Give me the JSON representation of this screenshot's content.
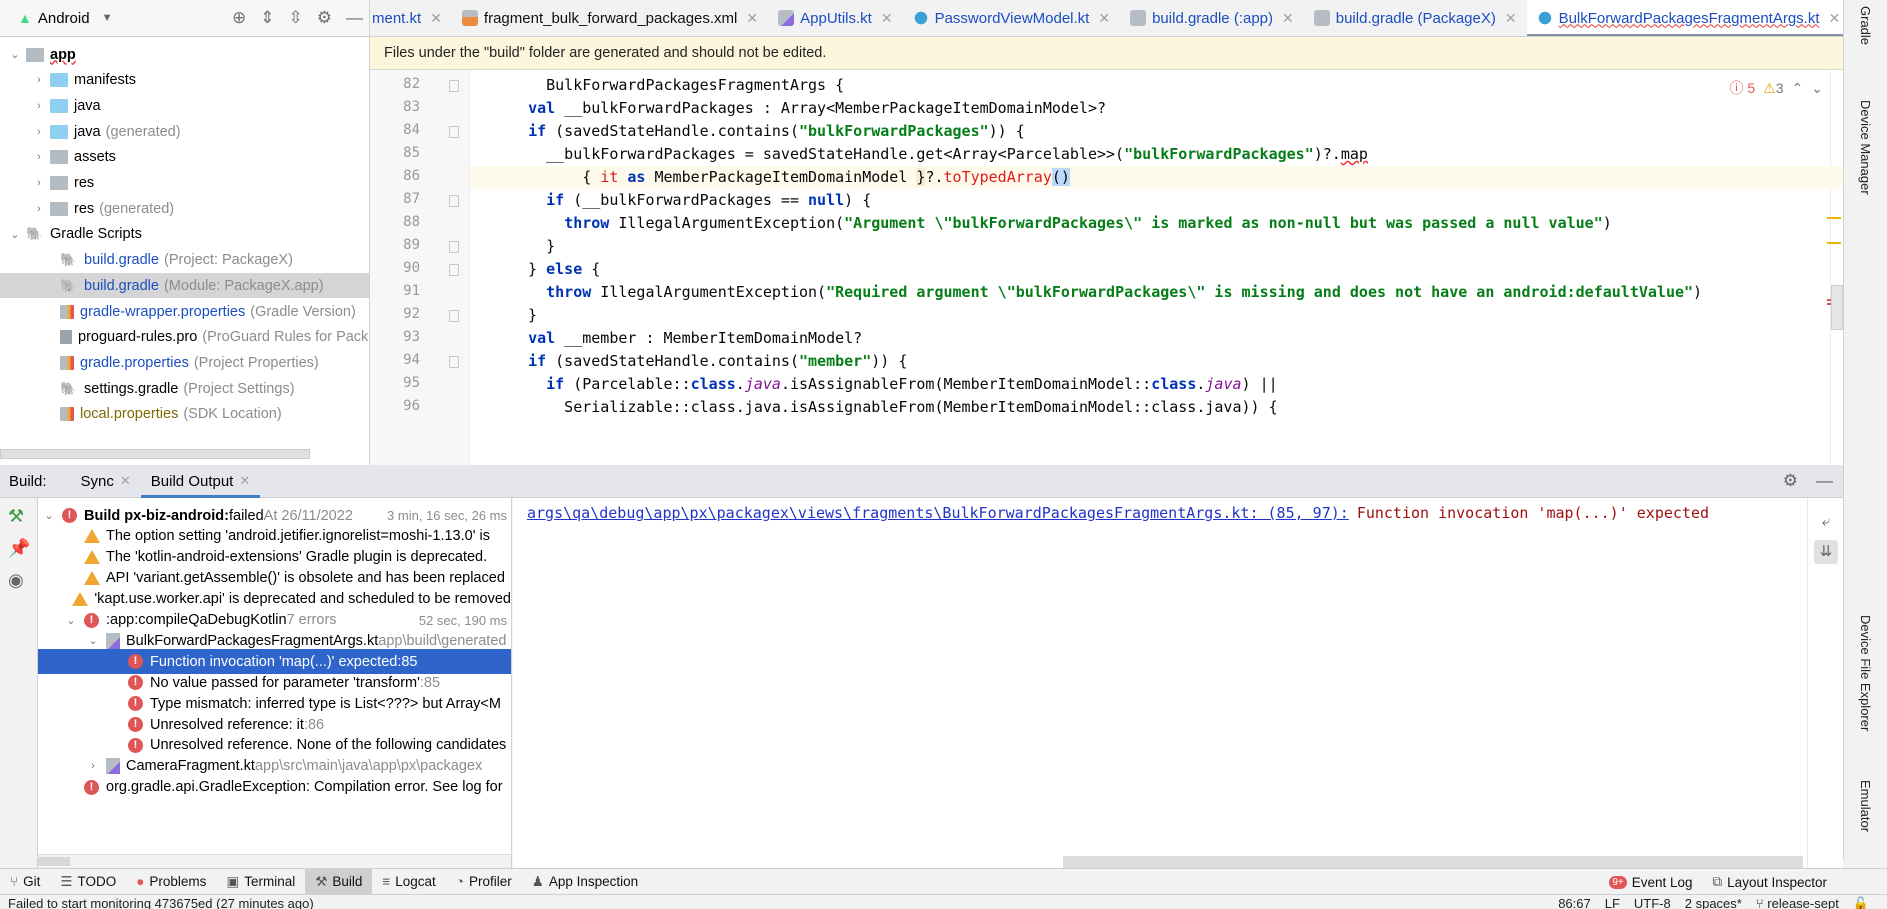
{
  "project_panel": {
    "view_selector": "Android",
    "tools": [
      "locate-icon",
      "expand-all-icon",
      "collapse-all-icon",
      "gear-icon",
      "minimize-icon"
    ],
    "tree": [
      {
        "label": "app",
        "detail": "",
        "level": 0,
        "expanded": true,
        "kind": "module",
        "bold": true
      },
      {
        "label": "manifests",
        "detail": "",
        "level": 1,
        "expanded": false,
        "kind": "folder-blue"
      },
      {
        "label": "java",
        "detail": "",
        "level": 1,
        "expanded": false,
        "kind": "folder-blue"
      },
      {
        "label": "java",
        "detail": "(generated)",
        "level": 1,
        "expanded": false,
        "kind": "folder-generated"
      },
      {
        "label": "assets",
        "detail": "",
        "level": 1,
        "expanded": false,
        "kind": "folder-res"
      },
      {
        "label": "res",
        "detail": "",
        "level": 1,
        "expanded": false,
        "kind": "folder-res"
      },
      {
        "label": "res",
        "detail": "(generated)",
        "level": 1,
        "expanded": false,
        "kind": "folder-res"
      },
      {
        "label": "Gradle Scripts",
        "detail": "",
        "level": 0,
        "expanded": true,
        "kind": "gradle"
      },
      {
        "label": "build.gradle",
        "detail": "(Project: PackageX)",
        "level": 1,
        "kind": "gradle-file",
        "color": "blue"
      },
      {
        "label": "build.gradle",
        "detail": "(Module: PackageX.app)",
        "level": 1,
        "kind": "gradle-file",
        "color": "blue",
        "selected": true
      },
      {
        "label": "gradle-wrapper.properties",
        "detail": "(Gradle Version)",
        "level": 1,
        "kind": "properties",
        "color": "blue"
      },
      {
        "label": "proguard-rules.pro",
        "detail": "(ProGuard Rules for Pack",
        "level": 1,
        "kind": "text-file",
        "color": "black"
      },
      {
        "label": "gradle.properties",
        "detail": "(Project Properties)",
        "level": 1,
        "kind": "properties",
        "color": "blue"
      },
      {
        "label": "settings.gradle",
        "detail": "(Project Settings)",
        "level": 1,
        "kind": "gradle-file",
        "color": "black"
      },
      {
        "label": "local.properties",
        "detail": "(SDK Location)",
        "level": 1,
        "kind": "properties",
        "color": "olive"
      }
    ]
  },
  "editor_tabs": [
    {
      "label": "ment.kt",
      "icon": "kotlin-file-icon",
      "active": false
    },
    {
      "label": "fragment_bulk_forward_packages.xml",
      "icon": "xml-file-icon",
      "active": false
    },
    {
      "label": "AppUtils.kt",
      "icon": "kotlin-file-icon",
      "active": false
    },
    {
      "label": "PasswordViewModel.kt",
      "icon": "kotlin-class-icon",
      "active": false
    },
    {
      "label": "build.gradle (:app)",
      "icon": "gradle-icon",
      "active": false
    },
    {
      "label": "build.gradle (PackageX)",
      "icon": "gradle-icon",
      "active": false
    },
    {
      "label": "BulkForwardPackagesFragmentArgs.kt",
      "icon": "kotlin-class-icon",
      "active": true,
      "has_errors": true
    }
  ],
  "banner": "Files under the \"build\" folder are generated and should not be edited.",
  "inspections": {
    "errors": "5",
    "warnings": "3"
  },
  "code": {
    "lines": [
      {
        "n": "82",
        "fold": true,
        "segs": [
          {
            "t": "    BulkForwardPackagesFragmentArgs {",
            "c": ""
          }
        ]
      },
      {
        "n": "83",
        "segs": [
          {
            "t": "  ",
            "c": ""
          },
          {
            "t": "val",
            "c": "kw"
          },
          {
            "t": " __bulkForwardPackages : Array<MemberPackageItemDomainModel>?",
            "c": ""
          }
        ]
      },
      {
        "n": "84",
        "fold": true,
        "segs": [
          {
            "t": "  ",
            "c": ""
          },
          {
            "t": "if",
            "c": "kw"
          },
          {
            "t": " (savedStateHandle.contains(",
            "c": ""
          },
          {
            "t": "\"bulkForwardPackages\"",
            "c": "str"
          },
          {
            "t": ")) {",
            "c": ""
          }
        ]
      },
      {
        "n": "85",
        "segs": [
          {
            "t": "    __bulkForwardPackages = savedStateHandle.get<Array<Parcelable>>(",
            "c": ""
          },
          {
            "t": "\"bulkForwardPackages\"",
            "c": "str"
          },
          {
            "t": ")?.",
            "c": ""
          },
          {
            "t": "map",
            "c": "err-u"
          }
        ]
      },
      {
        "n": "86",
        "hl": true,
        "segs": [
          {
            "t": "        { ",
            "c": ""
          },
          {
            "t": "it",
            "c": "red"
          },
          {
            "t": " ",
            "c": ""
          },
          {
            "t": "as",
            "c": "kw"
          },
          {
            "t": " MemberPackageItemDomainModel ",
            "c": ""
          },
          {
            "t": "}",
            "c": "ylbg"
          },
          {
            "t": "?.",
            "c": ""
          },
          {
            "t": "toTypedArray",
            "c": "red"
          },
          {
            "t": "()",
            "c": "bm"
          }
        ]
      },
      {
        "n": "87",
        "fold": true,
        "segs": [
          {
            "t": "    ",
            "c": ""
          },
          {
            "t": "if",
            "c": "kw"
          },
          {
            "t": " (__bulkForwardPackages == ",
            "c": ""
          },
          {
            "t": "null",
            "c": "kw"
          },
          {
            "t": ") {",
            "c": ""
          }
        ]
      },
      {
        "n": "88",
        "segs": [
          {
            "t": "      ",
            "c": ""
          },
          {
            "t": "throw",
            "c": "kw"
          },
          {
            "t": " IllegalArgumentException(",
            "c": ""
          },
          {
            "t": "\"Argument \\\"bulkForwardPackages\\\" is marked as non-null but was passed a null value\"",
            "c": "str"
          },
          {
            "t": ")",
            "c": ""
          }
        ]
      },
      {
        "n": "89",
        "fold": true,
        "segs": [
          {
            "t": "    }",
            "c": ""
          }
        ]
      },
      {
        "n": "90",
        "fold": true,
        "segs": [
          {
            "t": "  } ",
            "c": ""
          },
          {
            "t": "else",
            "c": "kw"
          },
          {
            "t": " {",
            "c": ""
          }
        ]
      },
      {
        "n": "91",
        "segs": [
          {
            "t": "    ",
            "c": ""
          },
          {
            "t": "throw",
            "c": "kw"
          },
          {
            "t": " IllegalArgumentException(",
            "c": ""
          },
          {
            "t": "\"Required argument \\\"bulkForwardPackages\\\" is missing and does not have an android:defaultValue\"",
            "c": "str"
          },
          {
            "t": ")",
            "c": ""
          }
        ]
      },
      {
        "n": "92",
        "fold": true,
        "segs": [
          {
            "t": "  }",
            "c": ""
          }
        ]
      },
      {
        "n": "93",
        "segs": [
          {
            "t": "  ",
            "c": ""
          },
          {
            "t": "val",
            "c": "kw"
          },
          {
            "t": " __member : MemberItemDomainModel?",
            "c": ""
          }
        ]
      },
      {
        "n": "94",
        "fold": true,
        "segs": [
          {
            "t": "  ",
            "c": ""
          },
          {
            "t": "if",
            "c": "kw"
          },
          {
            "t": " (savedStateHandle.contains(",
            "c": ""
          },
          {
            "t": "\"member\"",
            "c": "str"
          },
          {
            "t": ")) {",
            "c": ""
          }
        ]
      },
      {
        "n": "95",
        "segs": [
          {
            "t": "    ",
            "c": ""
          },
          {
            "t": "if",
            "c": "kw"
          },
          {
            "t": " (Parcelable::",
            "c": ""
          },
          {
            "t": "class",
            "c": "kw"
          },
          {
            "t": ".",
            "c": ""
          },
          {
            "t": "java",
            "c": "it"
          },
          {
            "t": ".isAssignableFrom(MemberItemDomainModel::",
            "c": ""
          },
          {
            "t": "class",
            "c": "kw"
          },
          {
            "t": ".",
            "c": ""
          },
          {
            "t": "java",
            "c": "it"
          },
          {
            "t": ") ||",
            "c": ""
          }
        ]
      },
      {
        "n": "96",
        "segs": [
          {
            "t": "      Serializable::class.java.isAssignableFrom(MemberItemDomainModel::class.java)) {",
            "c": ""
          }
        ]
      }
    ]
  },
  "right_strip": [
    "Gradle",
    "Device Manager",
    "Device File Explorer",
    "Emulator"
  ],
  "build_panel": {
    "label": "Build:",
    "tabs": [
      {
        "label": "Sync",
        "active": false
      },
      {
        "label": "Build Output",
        "active": true
      }
    ],
    "tree": [
      {
        "indent": 0,
        "chev": "down",
        "icon": "error",
        "bold": "Build px-biz-android:",
        "text": " failed",
        "gray": " At 26/11/2022",
        "time": "3 min, 16 sec, 26 ms"
      },
      {
        "indent": 1,
        "icon": "warning",
        "text": "The option setting 'android.jetifier.ignorelist=moshi-1.13.0' is"
      },
      {
        "indent": 1,
        "icon": "warning",
        "text": "The 'kotlin-android-extensions' Gradle plugin is deprecated."
      },
      {
        "indent": 1,
        "icon": "warning",
        "text": "API 'variant.getAssemble()' is obsolete and has been replaced"
      },
      {
        "indent": 1,
        "icon": "warning",
        "text": "'kapt.use.worker.api' is deprecated and scheduled to be removed"
      },
      {
        "indent": 1,
        "chev": "down",
        "icon": "error",
        "text": ":app:compileQaDebugKotlin",
        "gray": "  7 errors",
        "time": "52 sec, 190 ms"
      },
      {
        "indent": 2,
        "chev": "down",
        "icon": "kotlin-file",
        "text": "BulkForwardPackagesFragmentArgs.kt",
        "gray": " app\\build\\generated"
      },
      {
        "indent": 3,
        "icon": "error",
        "text": "Function invocation 'map(...)' expected",
        "gray": " :85",
        "selected": true
      },
      {
        "indent": 3,
        "icon": "error",
        "text": "No value passed for parameter 'transform'",
        "gray": " :85"
      },
      {
        "indent": 3,
        "icon": "error",
        "text": "Type mismatch: inferred type is List<???> but Array<M"
      },
      {
        "indent": 3,
        "icon": "error",
        "text": "Unresolved reference: it",
        "gray": " :86"
      },
      {
        "indent": 3,
        "icon": "error",
        "text": "Unresolved reference. None of the following candidates"
      },
      {
        "indent": 2,
        "chev": "right",
        "icon": "kotlin-file",
        "text": "CameraFragment.kt",
        "gray": " app\\src\\main\\java\\app\\px\\packagex"
      },
      {
        "indent": 1,
        "icon": "error",
        "text": "org.gradle.api.GradleException: Compilation error. See log for"
      }
    ],
    "console": {
      "link": "args\\qa\\debug\\app\\px\\packagex\\views\\fragments\\BulkForwardPackagesFragmentArgs.kt: (85, 97):",
      "message": "Function invocation 'map(...)' expected"
    }
  },
  "tool_windows": [
    {
      "label": "Git",
      "icon": "git-icon"
    },
    {
      "label": "TODO",
      "icon": "list-icon"
    },
    {
      "label": "Problems",
      "icon": "error-icon"
    },
    {
      "label": "Terminal",
      "icon": "terminal-icon"
    },
    {
      "label": "Build",
      "icon": "hammer-icon",
      "active": true
    },
    {
      "label": "Logcat",
      "icon": "logcat-icon"
    },
    {
      "label": "Profiler",
      "icon": "gauge-icon"
    },
    {
      "label": "App Inspection",
      "icon": "inspection-icon"
    }
  ],
  "tool_windows_right": [
    {
      "label": "Event Log",
      "badge": "9+"
    },
    {
      "label": "Layout Inspector"
    }
  ],
  "status_bar": {
    "message": "Failed to start monitoring 473675ed (27 minutes ago)",
    "position": "86:67",
    "line_sep": "LF",
    "encoding": "UTF-8",
    "indent": "2 spaces*",
    "branch": "release-sept"
  }
}
